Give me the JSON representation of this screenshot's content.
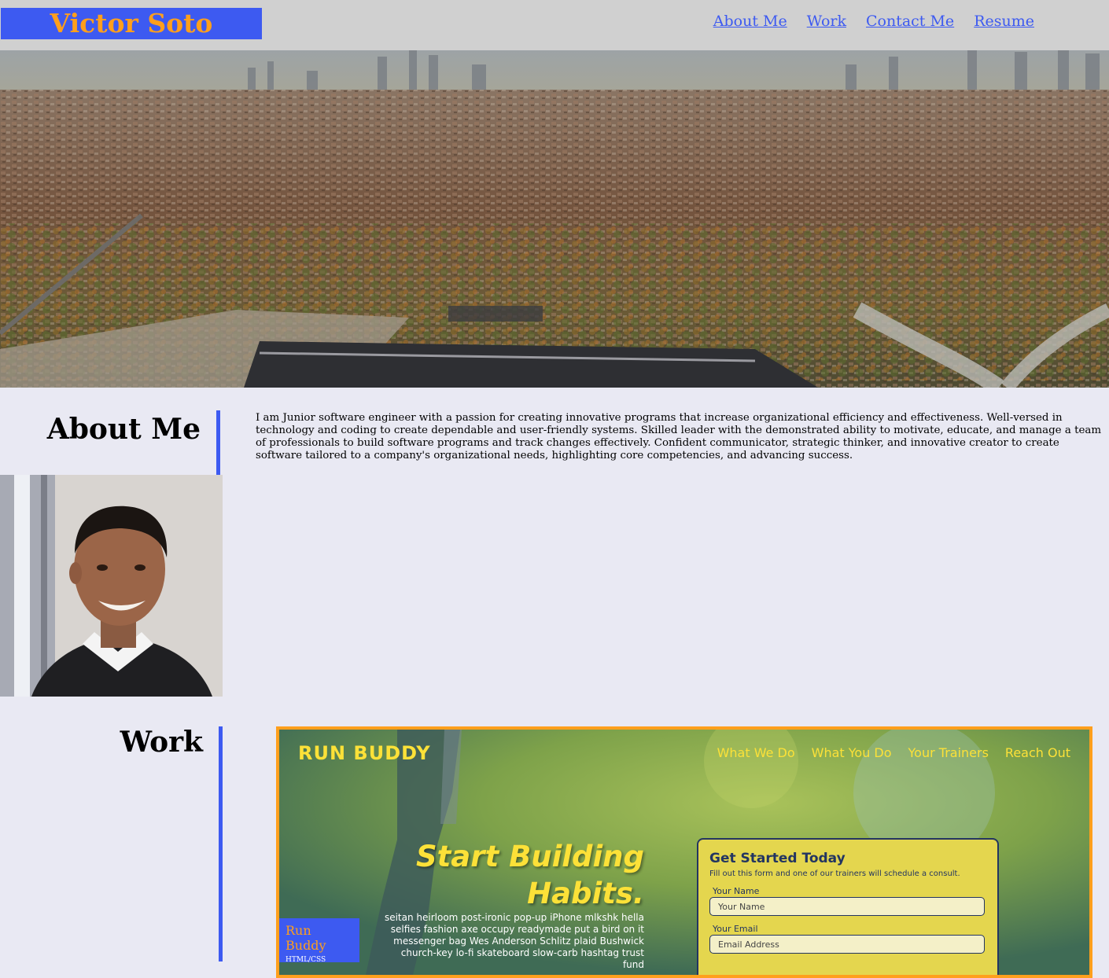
{
  "header": {
    "brand": "Victor Soto",
    "nav": [
      "About Me",
      "Work",
      "Contact Me",
      "Resume"
    ]
  },
  "colors": {
    "primary": "#3d5af1",
    "accent": "#ff9f1c",
    "background": "#e9e9f3",
    "header_bg": "#d0d0d0"
  },
  "about": {
    "heading": "About Me",
    "text": "I am Junior software engineer with a passion for creating innovative programs that increase organizational efficiency and effectiveness. Well-versed in technology and coding to create dependable and user-friendly systems. Skilled leader with the demonstrated ability to motivate, educate, and manage a team of professionals to build software programs and track changes effectively. Confident communicator, strategic thinker, and innovative creator to create software tailored to a company's organizational needs, highlighting core competencies, and advancing success."
  },
  "work": {
    "heading": "Work",
    "project": {
      "site_brand": "RUN BUDDY",
      "site_nav": [
        "What We Do",
        "What You Do",
        "Your Trainers",
        "Reach Out"
      ],
      "hero_title_1": "Start Building",
      "hero_title_2": "Habits.",
      "hero_text": "seitan heirloom post-ironic pop-up iPhone mlkshk hella selfies fashion axe occupy readymade put a bird on it messenger bag Wes Anderson Schlitz plaid Bushwick church-key lo-fi skateboard slow-carb hashtag trust fund",
      "form": {
        "title": "Get Started Today",
        "subtitle": "Fill out this form and one of our trainers will schedule a consult.",
        "name_label": "Your Name",
        "name_placeholder": "Your Name",
        "email_label": "Your Email",
        "email_placeholder": "Email Address"
      },
      "caption_title": "Run Buddy",
      "caption_tech": "HTML/CSS"
    }
  }
}
